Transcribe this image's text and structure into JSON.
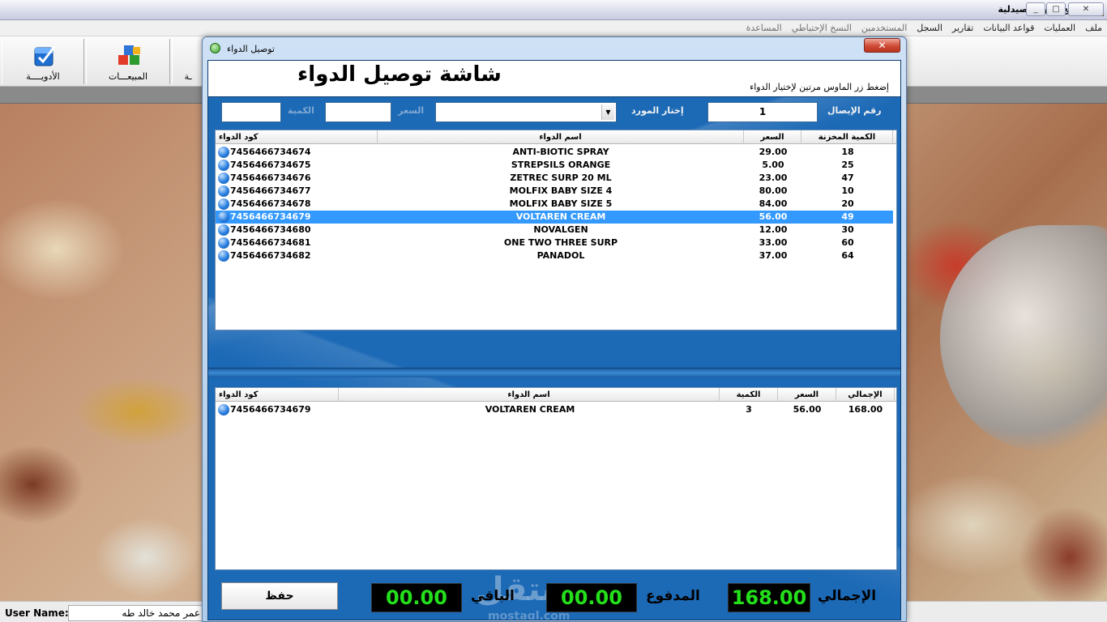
{
  "app": {
    "title": "برنامج إدارة الصيدلية",
    "window_buttons": [
      "_",
      "□",
      "✕"
    ]
  },
  "menu": [
    "ملف",
    "العمليات",
    "قواعد البيانات",
    "تقارير",
    "السجل",
    "المستخدمين",
    "النسخ الإحتياطي",
    "المساعدة"
  ],
  "toolbar": [
    {
      "label": "الأدويــــة",
      "icon": "medicine-check-icon"
    },
    {
      "label": "المبيعـــات",
      "icon": "sales-boxes-icon"
    },
    {
      "label": "ـة",
      "icon": ""
    }
  ],
  "status": {
    "user_label": "User Name:",
    "user_name": "عمر محمد خالد طه"
  },
  "dialog": {
    "title": "توصيل الدواء",
    "close": "✕",
    "heading": "شاشة توصيل الدواء",
    "hint": "إضغط زر الماوس مرتين لإختيار الدواء",
    "fields": {
      "receipt_label": "رقم الإيصال",
      "receipt_value": "1",
      "supplier_label": "إختار المورد",
      "supplier_value": "",
      "price_label": "السعر",
      "price_value": "",
      "qty_label": "الكمية",
      "qty_value": ""
    },
    "stock_columns": [
      "الكمية المخزنة",
      "السعر",
      "اسم الدواء",
      "كود الدواء"
    ],
    "stock_rows": [
      {
        "qty": "18",
        "price": "29.00",
        "name": "ANTI-BIOTIC SPRAY",
        "code": "7456466734674",
        "selected": false
      },
      {
        "qty": "25",
        "price": "5.00",
        "name": "STREPSILS ORANGE",
        "code": "7456466734675",
        "selected": false
      },
      {
        "qty": "47",
        "price": "23.00",
        "name": "ZETREC SURP 20 ML",
        "code": "7456466734676",
        "selected": false
      },
      {
        "qty": "10",
        "price": "80.00",
        "name": "MOLFIX BABY SIZE 4",
        "code": "7456466734677",
        "selected": false
      },
      {
        "qty": "20",
        "price": "84.00",
        "name": "MOLFIX BABY SIZE 5",
        "code": "7456466734678",
        "selected": false
      },
      {
        "qty": "49",
        "price": "56.00",
        "name": "VOLTAREN CREAM",
        "code": "7456466734679",
        "selected": true
      },
      {
        "qty": "30",
        "price": "12.00",
        "name": "NOVALGEN",
        "code": "7456466734680",
        "selected": false
      },
      {
        "qty": "60",
        "price": "33.00",
        "name": "ONE TWO THREE SURP",
        "code": "7456466734681",
        "selected": false
      },
      {
        "qty": "64",
        "price": "37.00",
        "name": "PANADOL",
        "code": "7456466734682",
        "selected": false
      }
    ],
    "cart_columns": [
      "الإجمالي",
      "السعر",
      "الكمية",
      "اسم الدواء",
      "كود الدواء"
    ],
    "cart_rows": [
      {
        "total": "168.00",
        "price": "56.00",
        "qty": "3",
        "name": "VOLTAREN CREAM",
        "code": "7456466734679"
      }
    ],
    "footer": {
      "save": "حفظ",
      "remaining_label": "الباقي",
      "remaining": "00.00",
      "paid_label": "المدفوع",
      "paid": "00.00",
      "total_label": "الإجمالي",
      "total": "168.00"
    }
  },
  "watermark": {
    "main": "مستقل",
    "sub": "mostaql.com"
  },
  "colors": {
    "dialog_blue": "#1c69b6",
    "selected_row": "#3399ff",
    "lcd_green": "#23e01b"
  }
}
